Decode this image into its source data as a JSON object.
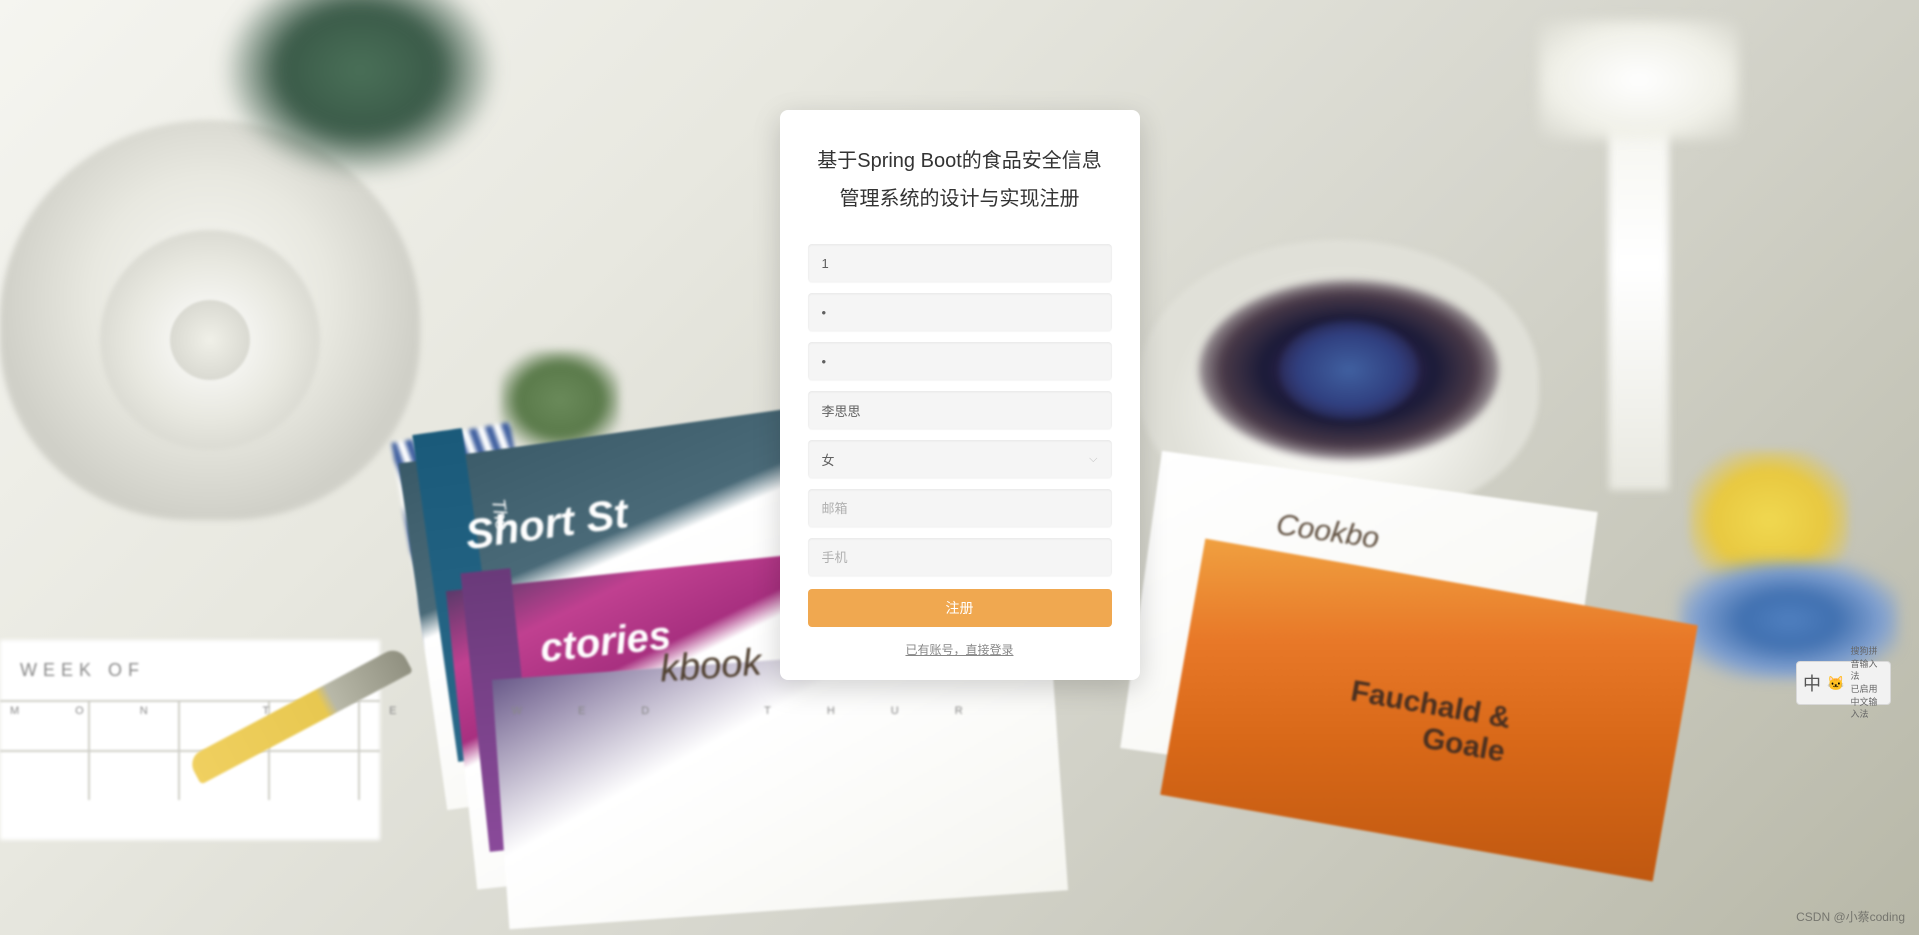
{
  "form": {
    "title": "基于Spring Boot的食品安全信息管理系统的设计与实现注册",
    "username_value": "1",
    "password_value": "•",
    "confirm_password_value": "•",
    "name_value": "李思思",
    "gender_value": "女",
    "email_placeholder": "邮箱",
    "phone_placeholder": "手机",
    "register_button_label": "注册",
    "login_link_text": "已有账号，直接登录"
  },
  "background": {
    "book_text_the": "The",
    "book_text_1": "Short St",
    "book_text_2": "ctories",
    "book_text_3": "kbook",
    "cookbook_text": "Cookbo",
    "cookbook_author": "Fauchald &\nGoale",
    "calendar_header": "WEEK OF",
    "calendar_days": "MON TUE WED THUR"
  },
  "ime": {
    "char": "中",
    "icon": "🐱",
    "text_line1": "搜狗拼音输入法",
    "text_line2": "已启用中文输入法"
  },
  "watermark": "CSDN @小蔡coding"
}
